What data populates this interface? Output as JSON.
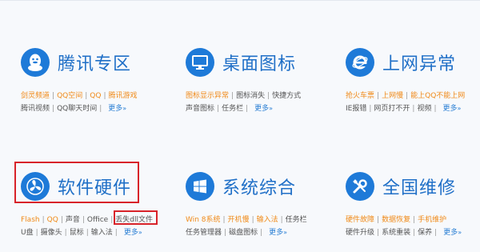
{
  "cards": [
    {
      "id": "tencent",
      "icon": "qq-penguin-icon",
      "title": "腾讯专区",
      "rows": [
        [
          {
            "label": "剑灵频道",
            "color": "orange"
          },
          {
            "label": "QQ空间",
            "color": "orange"
          },
          {
            "label": "QQ",
            "color": "orange"
          },
          {
            "label": "腾讯游戏",
            "color": "orange"
          }
        ],
        [
          {
            "label": "腾讯视频",
            "color": "gray"
          },
          {
            "label": "QQ聊天时间",
            "color": "gray"
          }
        ]
      ],
      "more": "更多"
    },
    {
      "id": "desktop",
      "icon": "monitor-icon",
      "title": "桌面图标",
      "rows": [
        [
          {
            "label": "图标显示异常",
            "color": "orange"
          },
          {
            "label": "图标消失",
            "color": "gray"
          },
          {
            "label": "快捷方式",
            "color": "gray"
          }
        ],
        [
          {
            "label": "声音图标",
            "color": "gray"
          },
          {
            "label": "任务栏",
            "color": "gray"
          }
        ]
      ],
      "more": "更多"
    },
    {
      "id": "internet",
      "icon": "ie-browser-icon",
      "title": "上网异常",
      "rows": [
        [
          {
            "label": "抢火车票",
            "color": "orange"
          },
          {
            "label": "上网慢",
            "color": "orange"
          },
          {
            "label": "能上QQ不能上网",
            "color": "orange"
          }
        ],
        [
          {
            "label": "IE报错",
            "color": "gray"
          },
          {
            "label": "网页打不开",
            "color": "gray"
          },
          {
            "label": "视频",
            "color": "gray"
          }
        ]
      ],
      "more": "更多"
    },
    {
      "id": "software",
      "icon": "fan-blades-icon",
      "title": "软件硬件",
      "rows": [
        [
          {
            "label": "Flash",
            "color": "orange"
          },
          {
            "label": "QQ",
            "color": "orange"
          },
          {
            "label": "声音",
            "color": "gray"
          },
          {
            "label": "Office",
            "color": "gray"
          },
          {
            "label": "丢失dll文件",
            "color": "gray"
          }
        ],
        [
          {
            "label": "U盘",
            "color": "gray"
          },
          {
            "label": "摄像头",
            "color": "gray"
          },
          {
            "label": "鼠标",
            "color": "gray"
          },
          {
            "label": "输入法",
            "color": "gray"
          }
        ]
      ],
      "more": "更多"
    },
    {
      "id": "system",
      "icon": "windows-logo-icon",
      "title": "系统综合",
      "rows": [
        [
          {
            "label": "Win 8系统",
            "color": "orange"
          },
          {
            "label": "开机慢",
            "color": "orange"
          },
          {
            "label": "输入法",
            "color": "orange"
          },
          {
            "label": "任务栏",
            "color": "gray"
          }
        ],
        [
          {
            "label": "任务管理器",
            "color": "gray"
          },
          {
            "label": "磁盘图标",
            "color": "gray"
          }
        ]
      ],
      "more": "更多"
    },
    {
      "id": "repair",
      "icon": "tools-icon",
      "title": "全国维修",
      "rows": [
        [
          {
            "label": "硬件故障",
            "color": "orange"
          },
          {
            "label": "数据恢复",
            "color": "orange"
          },
          {
            "label": "手机维护",
            "color": "orange"
          }
        ],
        [
          {
            "label": "硬件升级",
            "color": "gray"
          },
          {
            "label": "系统重装",
            "color": "gray"
          },
          {
            "label": "保养",
            "color": "gray"
          }
        ]
      ],
      "more": "更多"
    }
  ],
  "highlight_color": "#d8232a",
  "accent": "#1e7ad8",
  "orange": "#f08a18",
  "more_arrow": "»"
}
